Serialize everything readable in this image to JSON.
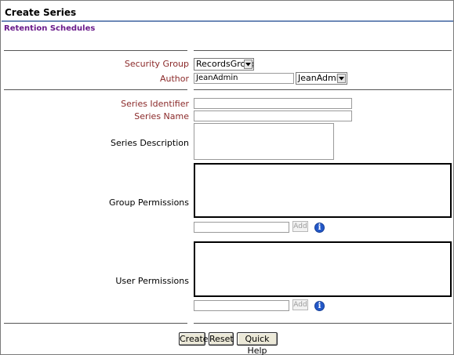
{
  "page": {
    "title": "Create Series",
    "subtitle": "Retention Schedules"
  },
  "form": {
    "security_group": {
      "label": "Security Group",
      "value": "RecordsGroup"
    },
    "author": {
      "label": "Author",
      "value": "JeanAdmin",
      "select_value": "JeanAdmin"
    },
    "series_identifier": {
      "label": "Series Identifier",
      "value": ""
    },
    "series_name": {
      "label": "Series Name",
      "value": ""
    },
    "series_description": {
      "label": "Series Description"
    },
    "group_permissions": {
      "label": "Group Permissions",
      "add_label": "Add",
      "info_icon": "info-icon"
    },
    "user_permissions": {
      "label": "User Permissions",
      "add_label": "Add",
      "info_icon": "info-icon"
    }
  },
  "actions": {
    "create": "Create",
    "reset": "Reset",
    "quick_help": "Quick Help"
  },
  "colors": {
    "required_label": "#8b2a2a",
    "subtitle": "#6a1b8a",
    "title_rule": "#6d89b7",
    "info": "#2358c8"
  }
}
